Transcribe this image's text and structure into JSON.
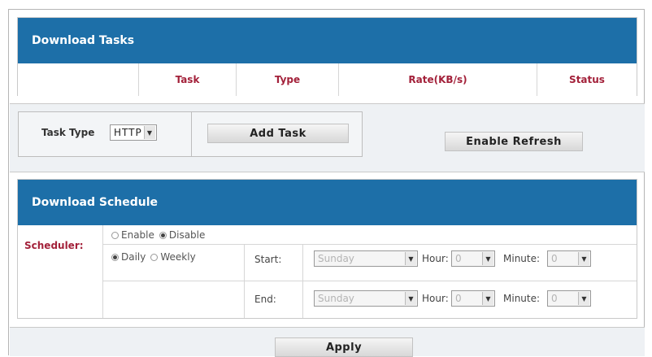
{
  "tasks": {
    "title": "Download Tasks",
    "columns": [
      "",
      "Task",
      "Type",
      "Rate(KB/s)",
      "Status"
    ]
  },
  "controls": {
    "task_type_label": "Task Type",
    "task_type_value": "HTTP",
    "add_task_label": "Add Task",
    "enable_refresh_label": "Enable Refresh"
  },
  "schedule": {
    "title": "Download Schedule",
    "scheduler_label": "Scheduler:",
    "enable_label": "Enable",
    "disable_label": "Disable",
    "scheduler_selected": "Disable",
    "daily_label": "Daily",
    "weekly_label": "Weekly",
    "frequency_selected": "Daily",
    "start_label": "Start:",
    "end_label": "End:",
    "hour_label": "Hour:",
    "minute_label": "Minute:",
    "start_day": "Sunday",
    "start_hour": "0",
    "start_minute": "0",
    "end_day": "Sunday",
    "end_hour": "0",
    "end_minute": "0"
  },
  "apply_label": "Apply",
  "colors": {
    "header_blue": "#1d6fa8",
    "label_red": "#a3213a",
    "controls_bg": "#eef1f4"
  }
}
